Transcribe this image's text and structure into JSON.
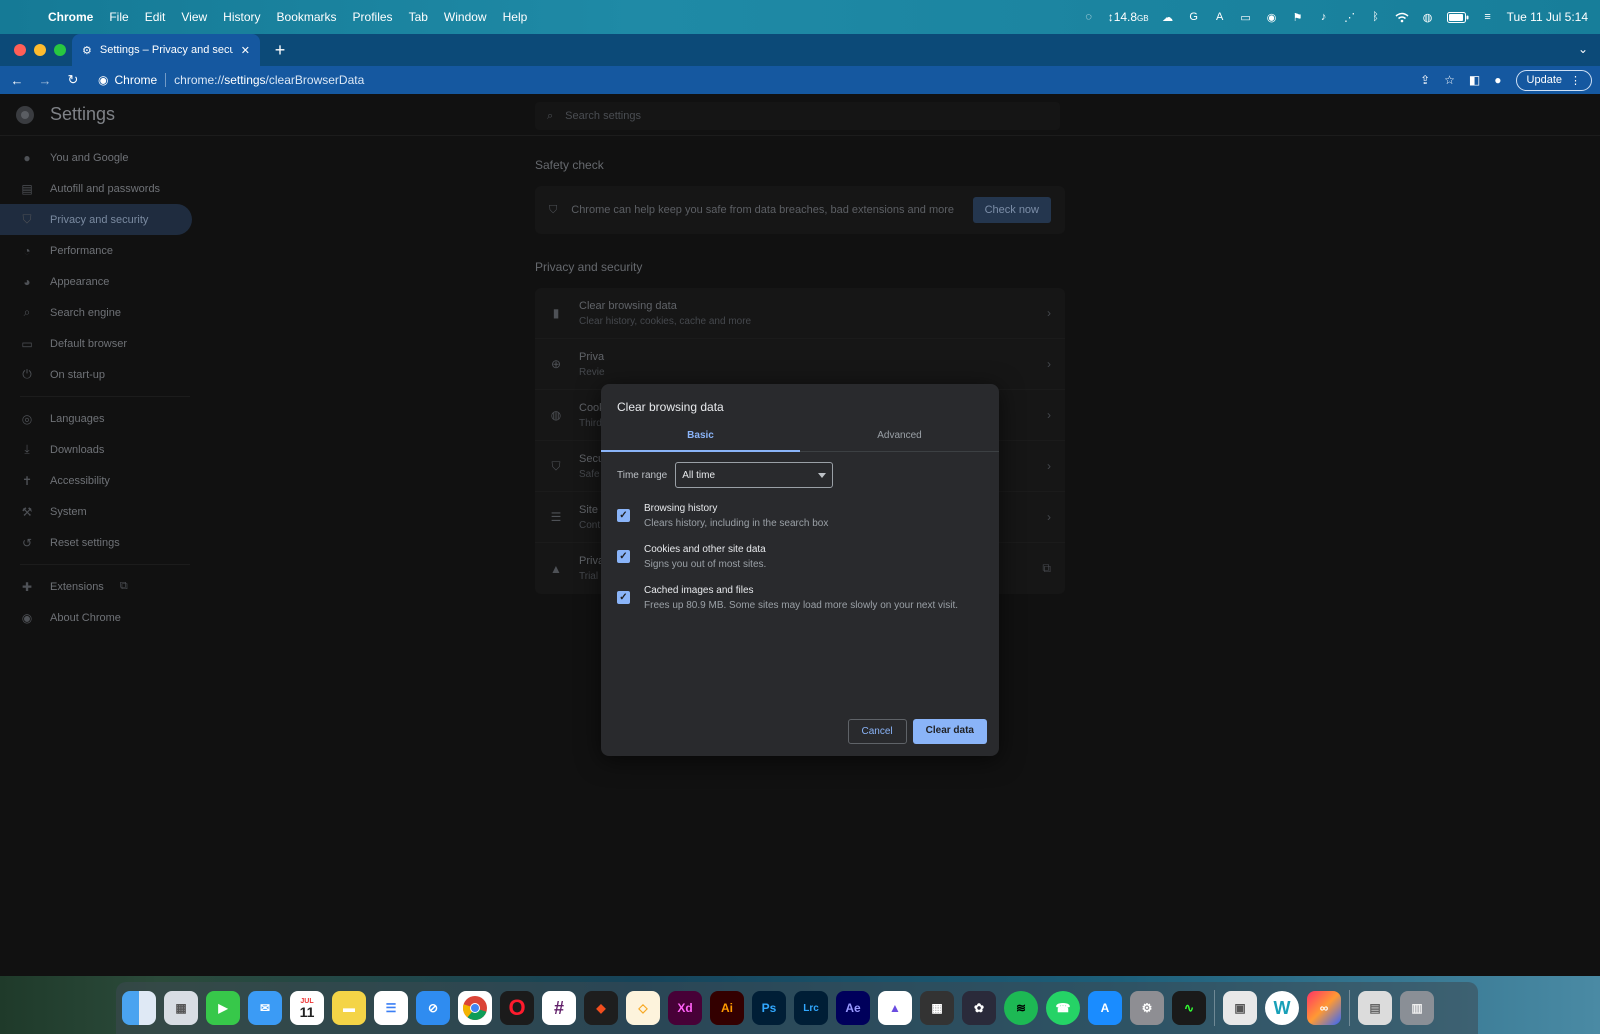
{
  "menubar": {
    "items": [
      "Chrome",
      "File",
      "Edit",
      "View",
      "History",
      "Bookmarks",
      "Profiles",
      "Tab",
      "Window",
      "Help"
    ],
    "storage": "↕14.8",
    "storage_unit": "GB",
    "datetime": "Tue 11 Jul  5:14"
  },
  "browser": {
    "tab_title": "Settings – Privacy and security",
    "omnibox_chip": "Chrome",
    "url_scheme": "chrome://",
    "url_host": "settings",
    "url_path": "/clearBrowserData",
    "update_label": "Update"
  },
  "settings": {
    "title": "Settings",
    "search_placeholder": "Search settings",
    "sidebar": [
      {
        "label": "You and Google",
        "icon": "person-icon"
      },
      {
        "label": "Autofill and passwords",
        "icon": "clipboard-icon"
      },
      {
        "label": "Privacy and security",
        "icon": "shield-icon"
      },
      {
        "label": "Performance",
        "icon": "gauge-icon"
      },
      {
        "label": "Appearance",
        "icon": "palette-icon"
      },
      {
        "label": "Search engine",
        "icon": "search-icon"
      },
      {
        "label": "Default browser",
        "icon": "browser-icon"
      },
      {
        "label": "On start-up",
        "icon": "power-icon"
      },
      {
        "label": "Languages",
        "icon": "globe-icon"
      },
      {
        "label": "Downloads",
        "icon": "download-icon"
      },
      {
        "label": "Accessibility",
        "icon": "accessibility-icon"
      },
      {
        "label": "System",
        "icon": "wrench-icon"
      },
      {
        "label": "Reset settings",
        "icon": "reset-icon"
      },
      {
        "label": "Extensions",
        "icon": "puzzle-icon"
      },
      {
        "label": "About Chrome",
        "icon": "chrome-icon"
      }
    ],
    "safety_check": {
      "title": "Safety check",
      "text": "Chrome can help keep you safe from data breaches, bad extensions and more",
      "button": "Check now"
    },
    "privacy": {
      "title": "Privacy and security",
      "rows": [
        {
          "name": "Clear browsing data",
          "desc": "Clear history, cookies, cache and more"
        },
        {
          "name": "Priva",
          "desc": "Revie"
        },
        {
          "name": "Cook",
          "desc": "Third"
        },
        {
          "name": "Secu",
          "desc": "Safe"
        },
        {
          "name": "Site s",
          "desc": "Cont"
        },
        {
          "name": "Priva",
          "desc": "Trial"
        }
      ]
    }
  },
  "dialog": {
    "title": "Clear browsing data",
    "tabs": [
      "Basic",
      "Advanced"
    ],
    "time_range_label": "Time range",
    "time_range_value": "All time",
    "options": [
      {
        "title": "Browsing history",
        "desc": "Clears history, including in the search box",
        "checked": true
      },
      {
        "title": "Cookies and other site data",
        "desc": "Signs you out of most sites.",
        "checked": true
      },
      {
        "title": "Cached images and files",
        "desc": "Frees up 80.9 MB. Some sites may load more slowly on your next visit.",
        "checked": true
      }
    ],
    "cancel": "Cancel",
    "confirm": "Clear data"
  },
  "dock": {
    "calendar_month": "JUL",
    "calendar_day": "11",
    "labels": {
      "xd": "Xd",
      "ai": "Ai",
      "ps": "Ps",
      "lrc": "Lrc",
      "ae": "Ae",
      "w": "W"
    }
  }
}
